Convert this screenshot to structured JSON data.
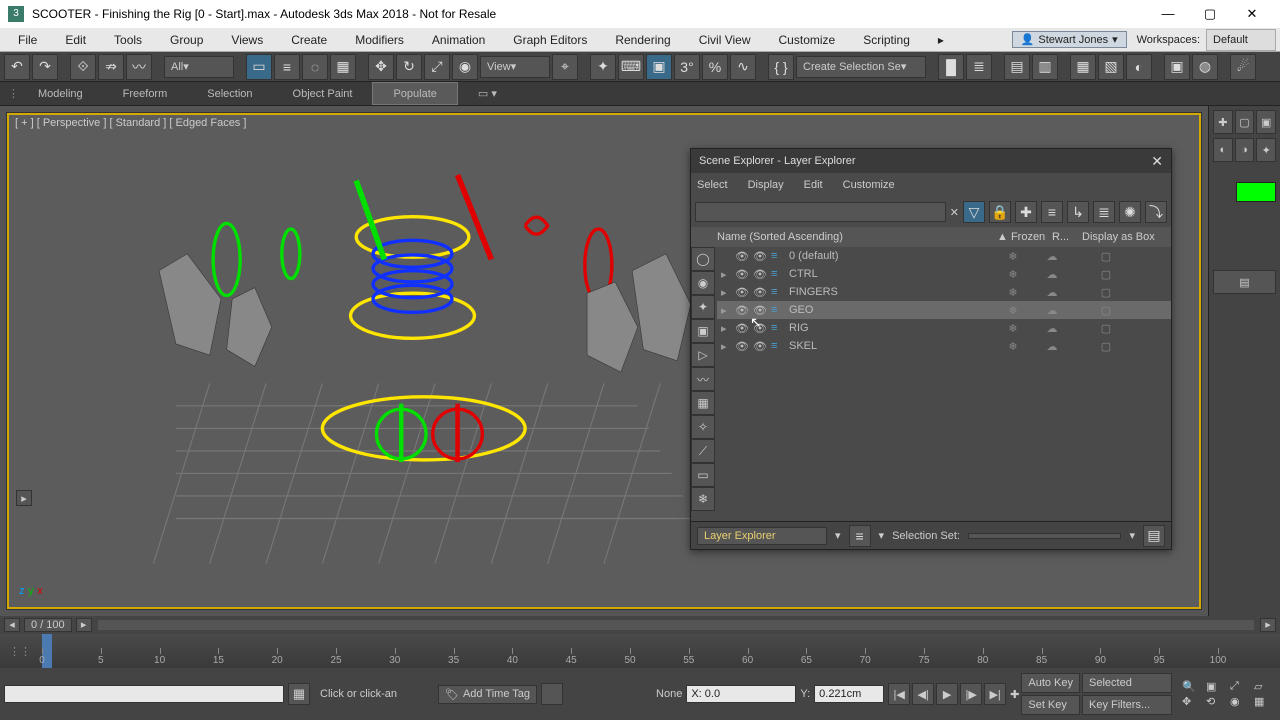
{
  "window": {
    "title": "SCOOTER - Finishing the Rig [0 - Start].max - Autodesk 3ds Max 2018 - Not for Resale",
    "min": "—",
    "max": "▢",
    "close": "✕"
  },
  "menubar": {
    "items": [
      "File",
      "Edit",
      "Tools",
      "Group",
      "Views",
      "Create",
      "Modifiers",
      "Animation",
      "Graph Editors",
      "Rendering",
      "Civil View",
      "Customize",
      "Scripting"
    ],
    "user": "Stewart Jones",
    "workspaces_label": "Workspaces:",
    "workspaces_value": "Default"
  },
  "toolbar1": {
    "filter": "All",
    "view_label": "View",
    "selset": "Create Selection Se"
  },
  "ribbon": {
    "tabs": [
      "Modeling",
      "Freeform",
      "Selection",
      "Object Paint",
      "Populate"
    ],
    "active": 4
  },
  "viewport": {
    "label": "[ + ] [ Perspective ] [ Standard ] [ Edged Faces ]"
  },
  "scene_explorer": {
    "title": "Scene Explorer - Layer Explorer",
    "menu": [
      "Select",
      "Display",
      "Edit",
      "Customize"
    ],
    "cols": {
      "name": "Name (Sorted Ascending)",
      "frozen": "▲ Frozen",
      "ren": "R...",
      "box": "Display as Box"
    },
    "rows": [
      {
        "name": "0 (default)",
        "expand": "",
        "sel": false
      },
      {
        "name": "CTRL",
        "expand": "▸",
        "sel": false
      },
      {
        "name": "FINGERS",
        "expand": "▸",
        "sel": false
      },
      {
        "name": "GEO",
        "expand": "▸",
        "sel": true
      },
      {
        "name": "RIG",
        "expand": "▸",
        "sel": false
      },
      {
        "name": "SKEL",
        "expand": "▸",
        "sel": false
      }
    ],
    "footer": {
      "mode": "Layer Explorer",
      "selset_label": "Selection Set:"
    }
  },
  "timeline": {
    "frame_display": "0 / 100",
    "ticks": [
      0,
      5,
      10,
      15,
      20,
      25,
      30,
      35,
      40,
      45,
      50,
      55,
      60,
      65,
      70,
      75,
      80,
      85,
      90,
      95,
      100
    ]
  },
  "status": {
    "hint": "Click or click-an",
    "timetag": "Add Time Tag",
    "coord_label": "None",
    "coord_x": "X: 0.0",
    "coord_y_lbl": "Y:",
    "coord_y": "0.221cm",
    "autokey": "Auto Key",
    "setkey": "Set Key",
    "selected": "Selected",
    "keyfilters": "Key Filters..."
  }
}
